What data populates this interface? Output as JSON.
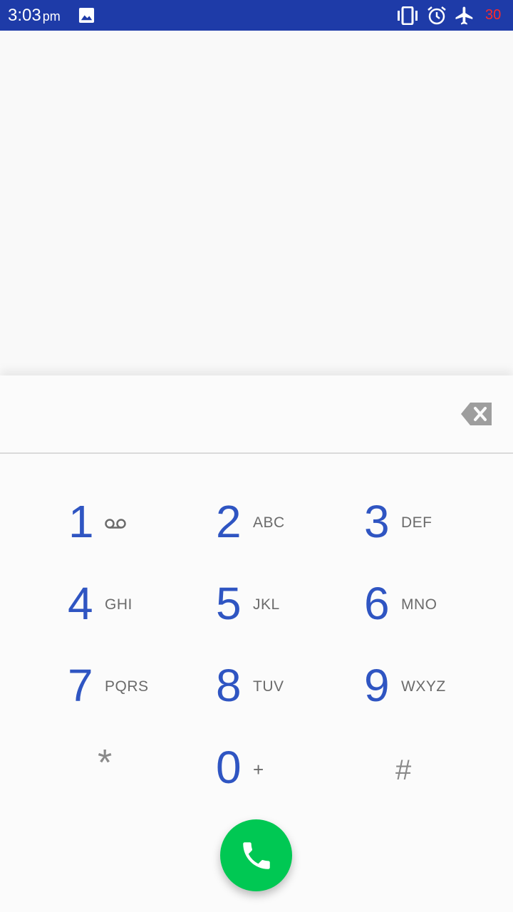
{
  "status_bar": {
    "time": "3:03",
    "ampm": "pm",
    "battery_level": "30",
    "icons": [
      "image-icon",
      "vibrate-icon",
      "alarm-icon",
      "airplane-icon"
    ]
  },
  "dialer": {
    "digits_value": "",
    "keys": [
      {
        "digit": "1",
        "letters": "",
        "icon": "voicemail-icon"
      },
      {
        "digit": "2",
        "letters": "ABC"
      },
      {
        "digit": "3",
        "letters": "DEF"
      },
      {
        "digit": "4",
        "letters": "GHI"
      },
      {
        "digit": "5",
        "letters": "JKL"
      },
      {
        "digit": "6",
        "letters": "MNO"
      },
      {
        "digit": "7",
        "letters": "PQRS"
      },
      {
        "digit": "8",
        "letters": "TUV"
      },
      {
        "digit": "9",
        "letters": "WXYZ"
      },
      {
        "digit": "*",
        "letters": ""
      },
      {
        "digit": "0",
        "letters": "+"
      },
      {
        "digit": "#",
        "letters": ""
      }
    ],
    "icons": [
      "backspace-icon",
      "phone-icon"
    ]
  },
  "colors": {
    "status_bar": "#1e3ba8",
    "digit": "#2f55c2",
    "call_button": "#00c853",
    "battery_low": "#ff2a2a"
  }
}
